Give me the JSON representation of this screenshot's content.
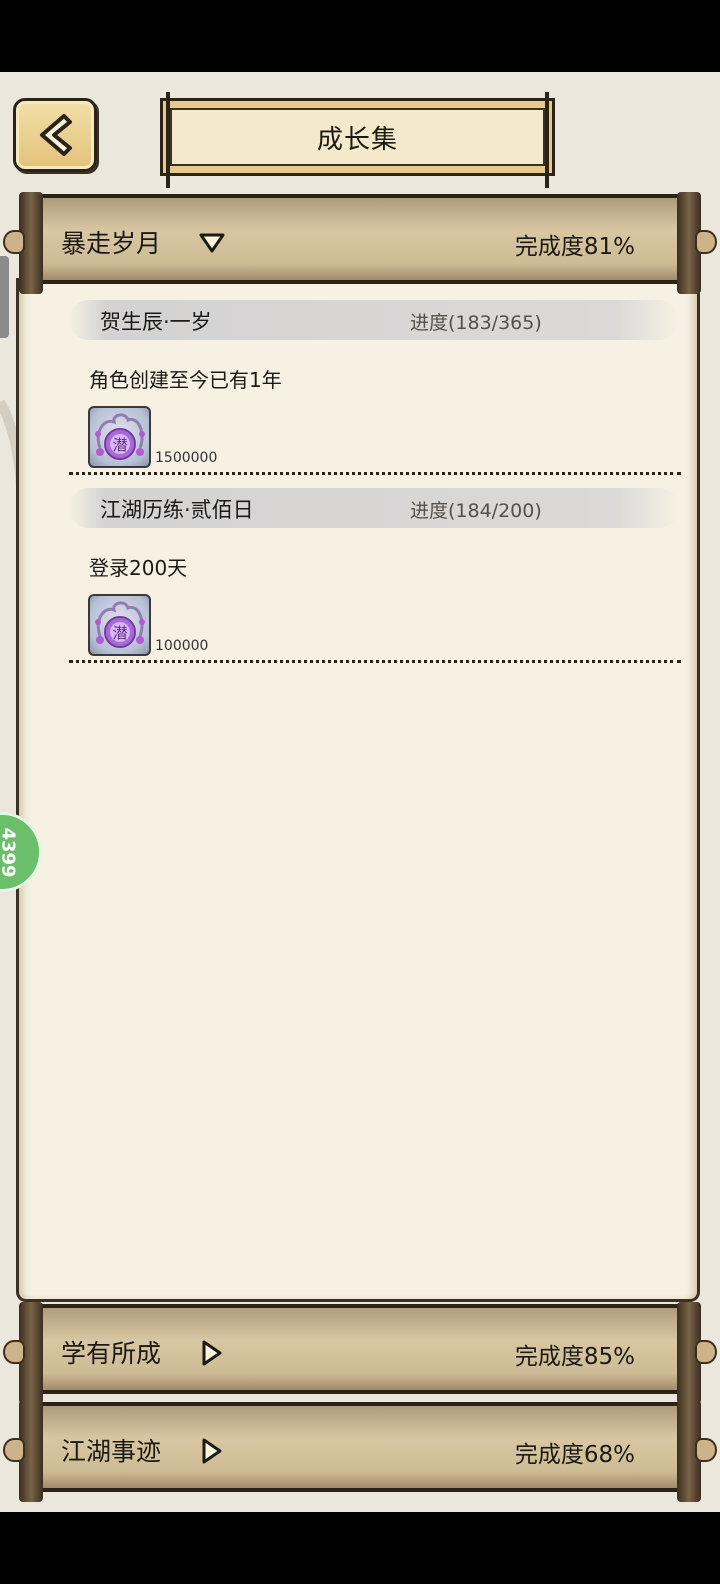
{
  "header": {
    "title": "成长集",
    "back_icon": "chevron-left-icon"
  },
  "sections": [
    {
      "label": "暴走岁月",
      "completion": "完成度81%",
      "expanded": true,
      "arrow_icon": "triangle-down-icon"
    },
    {
      "label": "学有所成",
      "completion": "完成度85%",
      "expanded": false,
      "arrow_icon": "triangle-right-icon"
    },
    {
      "label": "江湖事迹",
      "completion": "完成度68%",
      "expanded": false,
      "arrow_icon": "triangle-right-icon"
    }
  ],
  "tasks": [
    {
      "name": "贺生辰·一岁",
      "progress": "进度(183/365)",
      "description": "角色创建至今已有1年",
      "reward_icon": "potential-orb-icon",
      "reward_glyph": "潜",
      "reward_count": "1500000"
    },
    {
      "name": "江湖历练·贰佰日",
      "progress": "进度(184/200)",
      "description": "登录200天",
      "reward_icon": "potential-orb-icon",
      "reward_glyph": "潜",
      "reward_count": "100000"
    }
  ],
  "side_tab": {
    "label": "4399",
    "color": "#6bbf6a"
  },
  "colors": {
    "paper": "#f6f1e3",
    "bar": "#d8c7a2",
    "ink": "#1c1a16",
    "plaque": "#f5e9cc"
  }
}
